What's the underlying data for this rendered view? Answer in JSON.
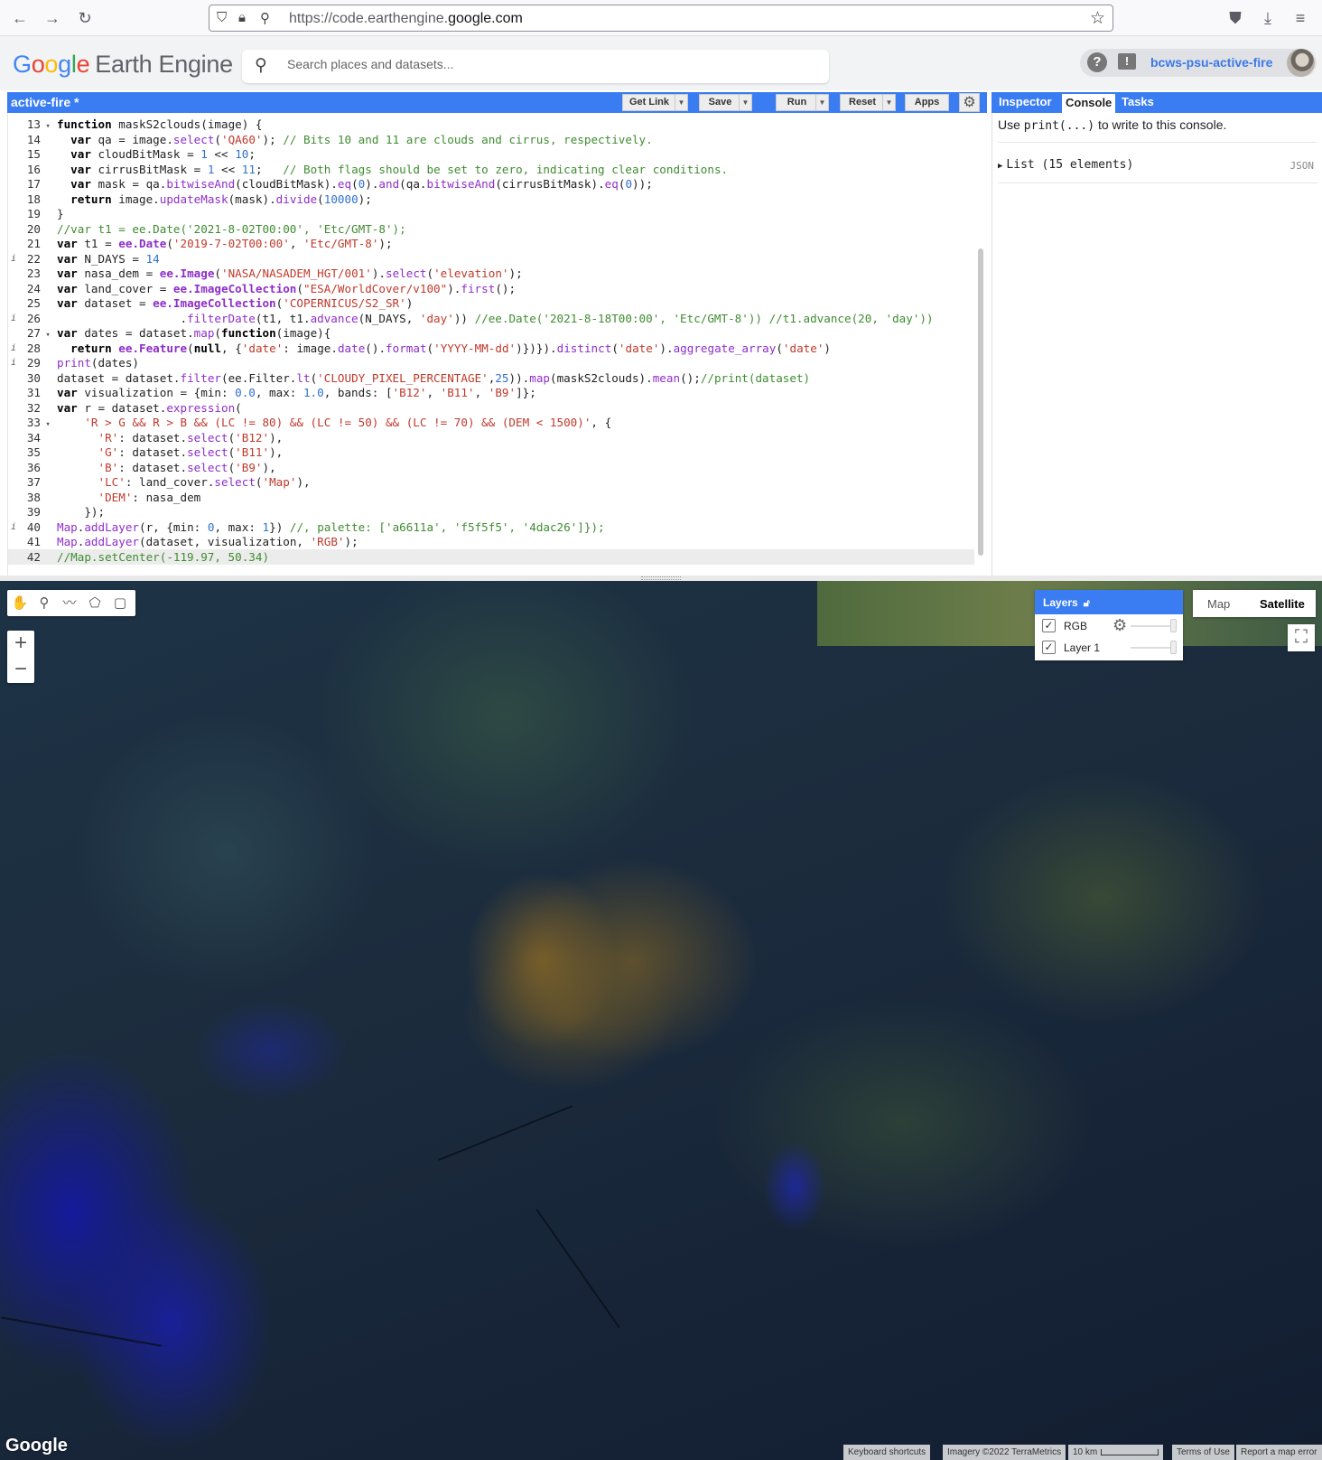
{
  "browser": {
    "url_prefix": "https://code.earthengine.",
    "url_domain": "google.com",
    "icons": [
      "back-icon",
      "forward-icon",
      "reload-icon",
      "shield-icon",
      "lock-icon",
      "permissions-icon",
      "star-icon",
      "pocket-icon",
      "download-icon",
      "menu-icon"
    ]
  },
  "header": {
    "logo_g": "Go",
    "logo_o": "o",
    "logo_gl": "g",
    "logo_le": "le",
    "logo_product": "Earth Engine",
    "search_placeholder": "Search places and datasets...",
    "project": "bcws-psu-active-fire",
    "help_glyph": "?",
    "feedback_glyph": "!"
  },
  "editor": {
    "title": "active-fire *",
    "buttons": {
      "get_link": "Get Link",
      "save": "Save",
      "run": "Run",
      "reset": "Reset",
      "apps": "Apps"
    },
    "lines": [
      {
        "n": "13",
        "fold": true,
        "info": false,
        "html": "<span class=\"k\">function</span> maskS2clouds(image) {"
      },
      {
        "n": "14",
        "fold": false,
        "info": false,
        "html": "  <span class=\"k\">var</span> qa = image.<span class=\"f\">select</span>(<span class=\"s\">'QA60'</span>); <span class=\"c\">// Bits 10 and 11 are clouds and cirrus, respectively.</span>"
      },
      {
        "n": "15",
        "fold": false,
        "info": false,
        "html": "  <span class=\"k\">var</span> cloudBitMask = <span class=\"n\">1</span> &lt;&lt; <span class=\"n\">10</span>;"
      },
      {
        "n": "16",
        "fold": false,
        "info": false,
        "html": "  <span class=\"k\">var</span> cirrusBitMask = <span class=\"n\">1</span> &lt;&lt; <span class=\"n\">11</span>;   <span class=\"c\">// Both flags should be set to zero, indicating clear conditions.</span>"
      },
      {
        "n": "17",
        "fold": false,
        "info": false,
        "html": "  <span class=\"k\">var</span> mask = qa.<span class=\"f\">bitwiseAnd</span>(cloudBitMask).<span class=\"f\">eq</span>(<span class=\"n\">0</span>).<span class=\"f\">and</span>(qa.<span class=\"f\">bitwiseAnd</span>(cirrusBitMask).<span class=\"f\">eq</span>(<span class=\"n\">0</span>));"
      },
      {
        "n": "18",
        "fold": false,
        "info": false,
        "html": "  <span class=\"k\">return</span> image.<span class=\"f\">updateMask</span>(mask).<span class=\"f\">divide</span>(<span class=\"n\">10000</span>);"
      },
      {
        "n": "19",
        "fold": false,
        "info": false,
        "html": "}"
      },
      {
        "n": "20",
        "fold": false,
        "info": false,
        "html": "<span class=\"c\">//var t1 = ee.Date('2021-8-02T00:00', 'Etc/GMT-8');</span>"
      },
      {
        "n": "21",
        "fold": false,
        "info": false,
        "html": "<span class=\"k\">var</span> t1 = <span class=\"e\">ee.Date</span>(<span class=\"s\">'2019-7-02T00:00'</span>, <span class=\"s\">'Etc/GMT-8'</span>);"
      },
      {
        "n": "22",
        "fold": false,
        "info": true,
        "html": "<span class=\"k\">var</span> N_DAYS = <span class=\"n\">14</span>"
      },
      {
        "n": "23",
        "fold": false,
        "info": false,
        "html": "<span class=\"k\">var</span> nasa_dem = <span class=\"e\">ee.Image</span>(<span class=\"s\">'NASA/NASADEM_HGT/001'</span>).<span class=\"f\">select</span>(<span class=\"s\">'elevation'</span>);"
      },
      {
        "n": "24",
        "fold": false,
        "info": false,
        "html": "<span class=\"k\">var</span> land_cover = <span class=\"e\">ee.ImageCollection</span>(<span class=\"s\">\"ESA/WorldCover/v100\"</span>).<span class=\"f\">first</span>();"
      },
      {
        "n": "25",
        "fold": false,
        "info": false,
        "html": "<span class=\"k\">var</span> dataset = <span class=\"e\">ee.ImageCollection</span>(<span class=\"s\">'COPERNICUS/S2_SR'</span>)"
      },
      {
        "n": "26",
        "fold": false,
        "info": true,
        "html": "                  .<span class=\"f\">filterDate</span>(t1, t1.<span class=\"f\">advance</span>(N_DAYS, <span class=\"s\">'day'</span>)) <span class=\"c\">//ee.Date('2021-8-18T00:00', 'Etc/GMT-8')) //t1.advance(20, 'day'))</span>"
      },
      {
        "n": "27",
        "fold": true,
        "info": false,
        "html": "<span class=\"k\">var</span> dates = dataset.<span class=\"f\">map</span>(<span class=\"k\">function</span>(image){"
      },
      {
        "n": "28",
        "fold": false,
        "info": true,
        "html": "  <span class=\"k\">return</span> <span class=\"e\">ee.Feature</span>(<span class=\"k\">null</span>, {<span class=\"s\">'date'</span>: image.<span class=\"f\">date</span>().<span class=\"f\">format</span>(<span class=\"s\">'YYYY-MM-dd'</span>)})}).<span class=\"f\">distinct</span>(<span class=\"s\">'date'</span>).<span class=\"f\">aggregate_array</span>(<span class=\"s\">'date'</span>)"
      },
      {
        "n": "29",
        "fold": false,
        "info": true,
        "html": "<span class=\"f\">print</span>(dates)"
      },
      {
        "n": "30",
        "fold": false,
        "info": false,
        "html": "dataset = dataset.<span class=\"f\">filter</span>(ee.Filter.<span class=\"f\">lt</span>(<span class=\"s\">'CLOUDY_PIXEL_PERCENTAGE'</span>,<span class=\"n\">25</span>)).<span class=\"f\">map</span>(maskS2clouds).<span class=\"f\">mean</span>();<span class=\"c\">//print(dataset)</span>"
      },
      {
        "n": "31",
        "fold": false,
        "info": false,
        "html": "<span class=\"k\">var</span> visualization = {min: <span class=\"n\">0.0</span>, max: <span class=\"n\">1.0</span>, bands: [<span class=\"s\">'B12'</span>, <span class=\"s\">'B11'</span>, <span class=\"s\">'B9'</span>]};"
      },
      {
        "n": "32",
        "fold": false,
        "info": false,
        "html": "<span class=\"k\">var</span> r = dataset.<span class=\"f\">expression</span>("
      },
      {
        "n": "33",
        "fold": true,
        "info": false,
        "html": "    <span class=\"s\">'R &gt; G &amp;&amp; R &gt; B &amp;&amp; (LC != 80) &amp;&amp; (LC != 50) &amp;&amp; (LC != 70) &amp;&amp; (DEM &lt; 1500)'</span>, {"
      },
      {
        "n": "34",
        "fold": false,
        "info": false,
        "html": "      <span class=\"s\">'R'</span>: dataset.<span class=\"f\">select</span>(<span class=\"s\">'B12'</span>),"
      },
      {
        "n": "35",
        "fold": false,
        "info": false,
        "html": "      <span class=\"s\">'G'</span>: dataset.<span class=\"f\">select</span>(<span class=\"s\">'B11'</span>),"
      },
      {
        "n": "36",
        "fold": false,
        "info": false,
        "html": "      <span class=\"s\">'B'</span>: dataset.<span class=\"f\">select</span>(<span class=\"s\">'B9'</span>),"
      },
      {
        "n": "37",
        "fold": false,
        "info": false,
        "html": "      <span class=\"s\">'LC'</span>: land_cover.<span class=\"f\">select</span>(<span class=\"s\">'Map'</span>),"
      },
      {
        "n": "38",
        "fold": false,
        "info": false,
        "html": "      <span class=\"s\">'DEM'</span>: nasa_dem"
      },
      {
        "n": "39",
        "fold": false,
        "info": false,
        "html": "    });"
      },
      {
        "n": "40",
        "fold": false,
        "info": true,
        "html": "<span class=\"f\">Map</span>.<span class=\"f\">addLayer</span>(r, {min: <span class=\"n\">0</span>, max: <span class=\"n\">1</span>}) <span class=\"c\">//, palette: ['a6611a', 'f5f5f5', '4dac26']});</span>"
      },
      {
        "n": "41",
        "fold": false,
        "info": false,
        "html": "<span class=\"f\">Map</span>.<span class=\"f\">addLayer</span>(dataset, visualization, <span class=\"s\">'RGB'</span>);"
      },
      {
        "n": "42",
        "fold": false,
        "info": false,
        "active": true,
        "html": "<span class=\"c\">//Map.setCenter(-119.97, 50.34)</span>"
      }
    ]
  },
  "right_panel": {
    "tabs": [
      "Inspector",
      "Console",
      "Tasks"
    ],
    "selected_tab": "Console",
    "hint_pre": "Use ",
    "hint_code": "print(...)",
    "hint_post": " to write to this console.",
    "list_label": "List (15 elements)",
    "json_label": "JSON"
  },
  "map": {
    "layers_title": "Layers",
    "layers": [
      {
        "name": "RGB",
        "checked": true,
        "opacity": 1.0
      },
      {
        "name": "Layer 1",
        "checked": true,
        "opacity": 1.0
      }
    ],
    "map_type_options": [
      "Map",
      "Satellite"
    ],
    "map_type_selected": "Satellite",
    "google_logo": "Google",
    "attribution": {
      "shortcuts": "Keyboard shortcuts",
      "imagery": "Imagery ©2022 TerraMetrics",
      "scale": "10 km",
      "terms": "Terms of Use",
      "report": "Report a map error"
    }
  }
}
